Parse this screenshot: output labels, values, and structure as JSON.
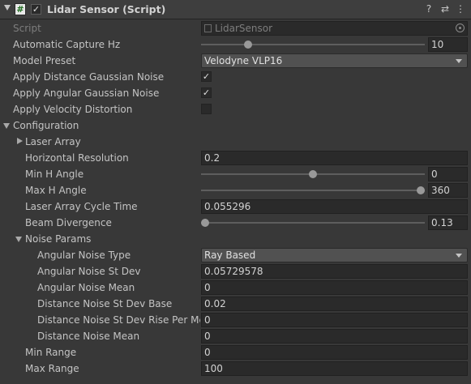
{
  "header": {
    "script_glyph": "#",
    "enabled_check": "✓",
    "title": "Lidar Sensor (Script)",
    "help_glyph": "?",
    "presets_glyph": "⇄",
    "menu_glyph": "⋮"
  },
  "properties": {
    "script": {
      "label": "Script",
      "value": "LidarSensor"
    },
    "capture_hz": {
      "label": "Automatic Capture Hz",
      "value": "10",
      "fraction": 0.2
    },
    "model_preset": {
      "label": "Model Preset",
      "value": "Velodyne VLP16"
    },
    "dist_noise": {
      "label": "Apply Distance Gaussian Noise",
      "checked": "✓"
    },
    "ang_noise": {
      "label": "Apply Angular Gaussian Noise",
      "checked": "✓"
    },
    "vel_distortion": {
      "label": "Apply Velocity Distortion",
      "checked": ""
    },
    "configuration": {
      "label": "Configuration"
    },
    "laser_array": {
      "label": "Laser Array"
    },
    "h_resolution": {
      "label": "Horizontal Resolution",
      "value": "0.2"
    },
    "min_h_angle": {
      "label": "Min H Angle",
      "value": "0",
      "fraction": 0.5
    },
    "max_h_angle": {
      "label": "Max H Angle",
      "value": "360",
      "fraction": 1.0
    },
    "cycle_time": {
      "label": "Laser Array Cycle Time",
      "value": "0.055296"
    },
    "beam_div": {
      "label": "Beam Divergence",
      "value": "0.13",
      "fraction": 0.0
    },
    "noise_params": {
      "label": "Noise Params"
    },
    "ang_noise_type": {
      "label": "Angular Noise Type",
      "value": "Ray Based"
    },
    "ang_noise_std": {
      "label": "Angular Noise St Dev",
      "value": "0.05729578"
    },
    "ang_noise_mean": {
      "label": "Angular Noise Mean",
      "value": "0"
    },
    "dist_std_base": {
      "label": "Distance Noise St Dev Base",
      "value": "0.02"
    },
    "dist_std_rise": {
      "label": "Distance Noise St Dev Rise Per Met",
      "value": "0"
    },
    "dist_noise_mean": {
      "label": "Distance Noise Mean",
      "value": "0"
    },
    "min_range": {
      "label": "Min Range",
      "value": "0"
    },
    "max_range": {
      "label": "Max Range",
      "value": "100"
    }
  }
}
